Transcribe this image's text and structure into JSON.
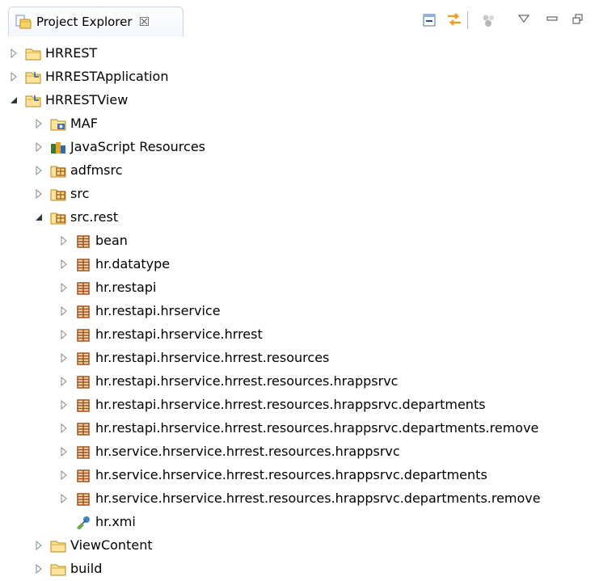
{
  "view": {
    "title": "Project Explorer",
    "close_glyph": "☒",
    "toolbar_icons": [
      "collapse-all-icon",
      "link-with-editor-icon",
      "focus-icon",
      "view-menu-icon",
      "minimize-icon",
      "maximize-icon"
    ]
  },
  "tree": [
    {
      "label": "HRREST",
      "icon": "folder-icon",
      "expanded": false,
      "depth": 0
    },
    {
      "label": "HRRESTApplication",
      "icon": "project-folder-icon",
      "expanded": false,
      "depth": 0
    },
    {
      "label": "HRRESTView",
      "icon": "project-folder-icon",
      "expanded": true,
      "depth": 0
    },
    {
      "label": "MAF",
      "icon": "maf-folder-icon",
      "expanded": false,
      "depth": 1
    },
    {
      "label": "JavaScript Resources",
      "icon": "javascript-resources-icon",
      "expanded": false,
      "depth": 1
    },
    {
      "label": "adfmsrc",
      "icon": "source-folder-icon",
      "expanded": false,
      "depth": 1
    },
    {
      "label": "src",
      "icon": "source-folder-icon",
      "expanded": false,
      "depth": 1
    },
    {
      "label": "src.rest",
      "icon": "source-folder-icon",
      "expanded": true,
      "depth": 1
    },
    {
      "label": "bean",
      "icon": "package-icon",
      "expanded": false,
      "depth": 2
    },
    {
      "label": "hr.datatype",
      "icon": "package-icon",
      "expanded": false,
      "depth": 2
    },
    {
      "label": "hr.restapi",
      "icon": "package-icon",
      "expanded": false,
      "depth": 2
    },
    {
      "label": "hr.restapi.hrservice",
      "icon": "package-icon",
      "expanded": false,
      "depth": 2
    },
    {
      "label": "hr.restapi.hrservice.hrrest",
      "icon": "package-icon",
      "expanded": false,
      "depth": 2
    },
    {
      "label": "hr.restapi.hrservice.hrrest.resources",
      "icon": "package-icon",
      "expanded": false,
      "depth": 2
    },
    {
      "label": "hr.restapi.hrservice.hrrest.resources.hrappsrvc",
      "icon": "package-icon",
      "expanded": false,
      "depth": 2
    },
    {
      "label": "hr.restapi.hrservice.hrrest.resources.hrappsrvc.departments",
      "icon": "package-icon",
      "expanded": false,
      "depth": 2
    },
    {
      "label": "hr.restapi.hrservice.hrrest.resources.hrappsrvc.departments.remove",
      "icon": "package-icon",
      "expanded": false,
      "depth": 2
    },
    {
      "label": "hr.service.hrservice.hrrest.resources.hrappsrvc",
      "icon": "package-icon",
      "expanded": false,
      "depth": 2
    },
    {
      "label": "hr.service.hrservice.hrrest.resources.hrappsrvc.departments",
      "icon": "package-icon",
      "expanded": false,
      "depth": 2
    },
    {
      "label": "hr.service.hrservice.hrrest.resources.hrappsrvc.departments.remove",
      "icon": "package-icon",
      "expanded": false,
      "depth": 2
    },
    {
      "label": "hr.xmi",
      "icon": "xmi-file-icon",
      "expanded": null,
      "depth": 2
    },
    {
      "label": "ViewContent",
      "icon": "folder-icon",
      "expanded": false,
      "depth": 1
    },
    {
      "label": "build",
      "icon": "folder-icon",
      "expanded": false,
      "depth": 1
    }
  ]
}
